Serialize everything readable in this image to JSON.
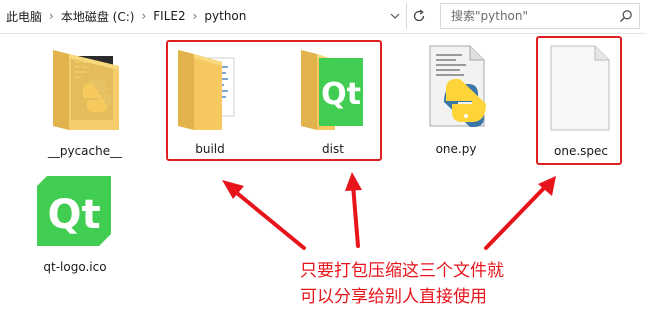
{
  "address_bar": {
    "breadcrumbs": [
      "此电脑",
      "本地磁盘 (C:)",
      "FILE2",
      "python"
    ],
    "search_placeholder": "搜索\"python\""
  },
  "files": [
    {
      "name": "__pycache__",
      "icon": "folder-python-icon"
    },
    {
      "name": "build",
      "icon": "folder-icon"
    },
    {
      "name": "dist",
      "icon": "folder-qt-icon"
    },
    {
      "name": "one.py",
      "icon": "python-file-icon"
    },
    {
      "name": "one.spec",
      "icon": "blank-file-icon"
    },
    {
      "name": "qt-logo.ico",
      "icon": "qt-logo-icon"
    }
  ],
  "annotation": {
    "line1": "只要打包压缩这三个文件就",
    "line2": "可以分享给别人直接使用"
  },
  "colors": {
    "annotation_red": "#e8141b",
    "folder_yellow": "#f5c960",
    "qt_green": "#41cd52",
    "python_blue": "#3b77a8",
    "python_yellow": "#ffd43b"
  }
}
